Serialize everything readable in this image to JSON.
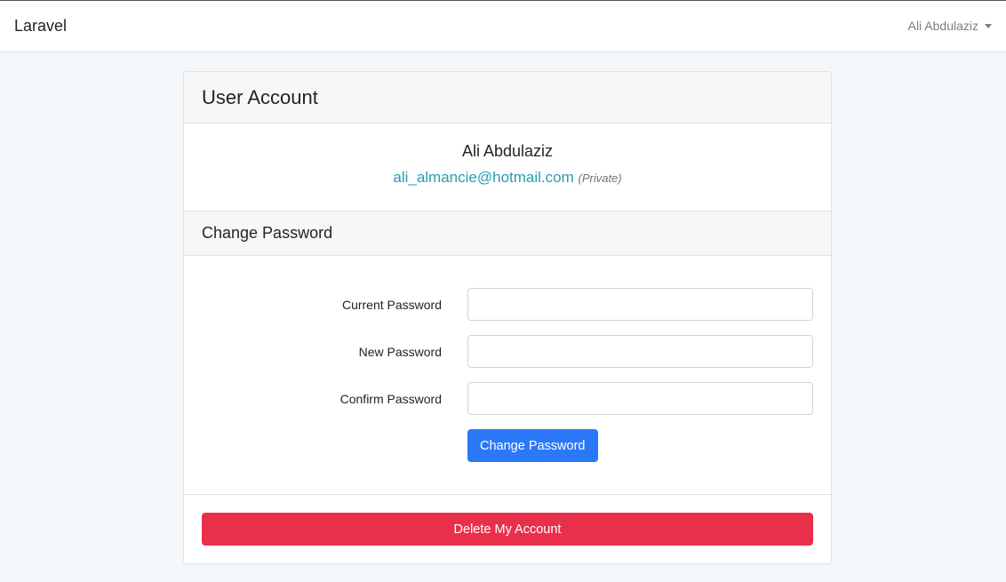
{
  "navbar": {
    "brand": "Laravel",
    "user_name": "Ali Abdulaziz"
  },
  "card": {
    "title": "User Account"
  },
  "profile": {
    "name": "Ali Abdulaziz",
    "email": "ali_almancie@hotmail.com",
    "privacy_note": "(Private)"
  },
  "change_password": {
    "title": "Change Password",
    "fields": {
      "current": {
        "label": "Current Password",
        "value": "",
        "placeholder": ""
      },
      "new": {
        "label": "New Password",
        "value": "",
        "placeholder": ""
      },
      "confirm": {
        "label": "Confirm Password",
        "value": "",
        "placeholder": ""
      }
    },
    "submit_label": "Change Password"
  },
  "delete_account": {
    "label": "Delete My Account"
  },
  "colors": {
    "primary": "#2b78f6",
    "danger": "#e9304a",
    "link": "#2a9bb0",
    "background": "#f4f7fa"
  }
}
